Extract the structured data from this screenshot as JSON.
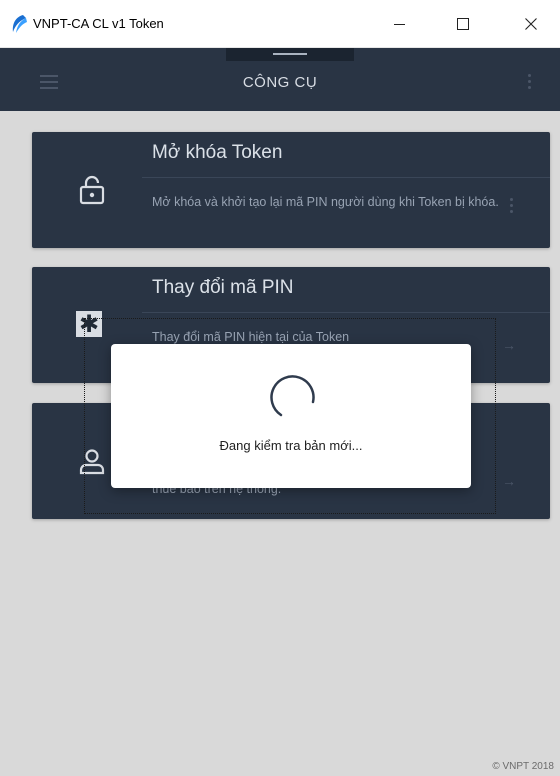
{
  "window": {
    "title": "VNPT-CA CL v1 Token",
    "minimize_glyph": "—",
    "maximize_glyph": "☐",
    "close_glyph": "✕",
    "icon": "vnpt-logo-icon"
  },
  "appbar": {
    "title": "CÔNG CỤ",
    "left_icon": "menu-icon",
    "right_icon": "more-vertical-icon",
    "background": "#293444"
  },
  "cards": [
    {
      "title": "Mở khóa Token",
      "description": "Mở khóa và khởi tạo lại mã PIN người dùng khi Token bị khóa.",
      "icon": "unlock-icon",
      "action_icon": "more-vertical-icon"
    },
    {
      "title": "Thay đổi mã PIN",
      "description": "Thay đổi mã PIN hiện tại của Token",
      "icon": "asterisk-icon",
      "action_icon": "arrow-right-icon"
    },
    {
      "title": "",
      "description": "thuê bao trên hệ thống.",
      "icon": "user-icon",
      "action_icon": "arrow-right-icon"
    }
  ],
  "modal": {
    "message": "Đang kiểm tra bản mới...",
    "icon": "loading-spinner-icon"
  },
  "footer": {
    "copyright": "© VNPT 2018"
  }
}
